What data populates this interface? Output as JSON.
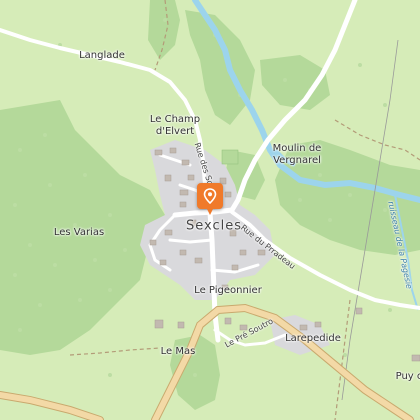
{
  "map": {
    "places": [
      {
        "id": "langlade",
        "label": "Langlade"
      },
      {
        "id": "le-champ-delvert",
        "label": "Le Champ\nd'Elvert"
      },
      {
        "id": "moulin-de-vergnarel",
        "label": "Moulin de\nVergnarel"
      },
      {
        "id": "les-varias",
        "label": "Les Varias"
      },
      {
        "id": "le-pigeonnier",
        "label": "Le Pigeonnier"
      },
      {
        "id": "le-mas",
        "label": "Le Mas"
      },
      {
        "id": "larepedide",
        "label": "Larepedide"
      },
      {
        "id": "puy",
        "label": "Puy c"
      }
    ],
    "town": {
      "label": "Sexcles"
    },
    "roads": [
      {
        "id": "rue-des-sources",
        "label": "Rue des Sour"
      },
      {
        "id": "rue-du-prradeau",
        "label": "Rue du Prradeau"
      },
      {
        "id": "le-pre-soutro",
        "label": "Le Pré Soutro"
      }
    ],
    "waterways": [
      {
        "id": "ruisseau-de-la-pages",
        "label": "ruisseau de la Pagesie"
      }
    ],
    "marker": {
      "icon": "map-pin-icon",
      "color": "#f07a2a"
    },
    "colors": {
      "land": "#d6ecb8",
      "forest": "#b4d99a",
      "residential": "#d9d9dc",
      "road": "#ffffff",
      "major_road": "#f3d9a6",
      "major_road_casing": "#c9a96e",
      "water": "#9cd4ec",
      "building": "#c2b9b0"
    }
  }
}
